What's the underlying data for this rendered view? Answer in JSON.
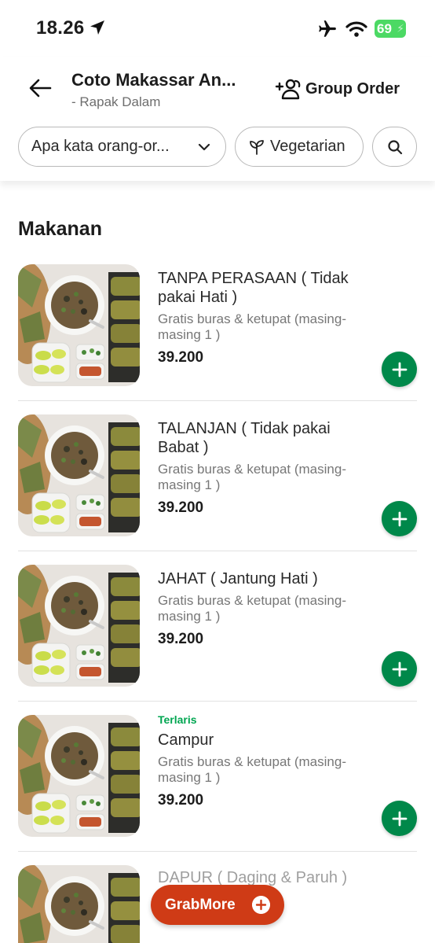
{
  "status_bar": {
    "time": "18.26",
    "battery": "69"
  },
  "header": {
    "store_name": "Coto Makassar An...",
    "store_location": "- Rapak Dalam",
    "group_order_label": "Group Order",
    "filter_chip": "Apa kata orang-or...",
    "vegetarian_chip": "Vegetarian"
  },
  "section": {
    "title": "Makanan"
  },
  "items": [
    {
      "badge": "",
      "name": "TANPA PERASAAN ( Tidak pakai Hati )",
      "desc": "Gratis buras & ketupat (masing-masing 1 )",
      "price": "39.200"
    },
    {
      "badge": "",
      "name": "TALANJAN ( Tidak pakai Babat )",
      "desc": "Gratis buras & ketupat (masing-masing 1 )",
      "price": "39.200"
    },
    {
      "badge": "",
      "name": "JAHAT ( Jantung Hati )",
      "desc": "Gratis buras & ketupat (masing-masing 1 )",
      "price": "39.200"
    },
    {
      "badge": "Terlaris",
      "name": "Campur",
      "desc": "Gratis buras & ketupat (masing-masing 1 )",
      "price": "39.200"
    },
    {
      "badge": "",
      "name": "DAPUR ( Daging & Paruh )",
      "desc": "",
      "price": ""
    }
  ],
  "grabmore": {
    "label": "GrabMore"
  },
  "colors": {
    "brand_green": "#00884a",
    "badge_green": "#00a651",
    "grabmore_red": "#cf3b16",
    "battery_green": "#4cd964"
  }
}
